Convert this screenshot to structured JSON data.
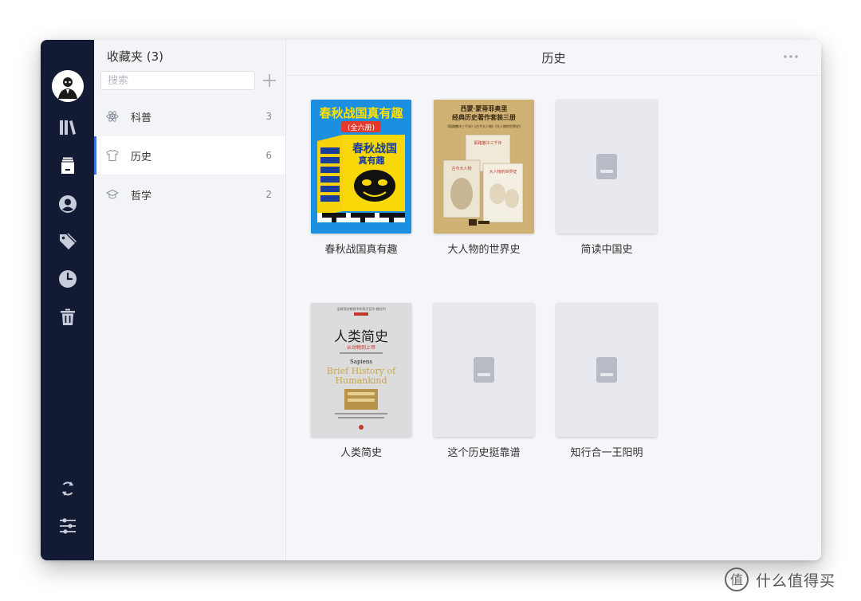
{
  "sidebar_nav": {
    "items": [
      {
        "name": "library-icon"
      },
      {
        "name": "collections-icon",
        "active": true
      },
      {
        "name": "user-icon"
      },
      {
        "name": "tag-icon"
      },
      {
        "name": "clock-icon"
      },
      {
        "name": "trash-icon"
      }
    ],
    "bottom": [
      {
        "name": "sync-icon"
      },
      {
        "name": "settings-sliders-icon"
      }
    ],
    "active_color": "#ffffff",
    "icon_color": "#c7ccda"
  },
  "collections_panel": {
    "title": "收藏夹 (3)",
    "search_placeholder": "搜索",
    "search_value": "",
    "add_icon": "plus-icon",
    "items": [
      {
        "icon": "atom-icon",
        "label": "科普",
        "count": "3"
      },
      {
        "icon": "shirt-icon",
        "label": "历史",
        "count": "6",
        "active": true
      },
      {
        "icon": "graduation-cap-icon",
        "label": "哲学",
        "count": "2"
      }
    ],
    "accent_color": "#3c72e6"
  },
  "main": {
    "title": "历史",
    "more_icon": "more-dots-icon",
    "books": [
      {
        "title": "春秋战国真有趣",
        "cover": {
          "type": "art-cspring",
          "headline": "春秋战国真有趣",
          "subtitle": "(全六册)",
          "box_title_1": "春秋战国",
          "box_title_2": "真有趣"
        }
      },
      {
        "title": "大人物的世界史",
        "cover": {
          "type": "art-bigpeople",
          "line1": "西蒙·蒙蒂菲奥里",
          "line2": "经典历史著作套装三册",
          "line3": "《耶路撒冷三千年》《古今大人物》《大人物的世界史》",
          "b1": "耶路撒冷三千年",
          "b2": "古今大人物",
          "b3": "大人物的世界史"
        }
      },
      {
        "title": "简读中国史",
        "cover": {
          "type": "placeholder"
        }
      },
      {
        "title": "人类简史",
        "cover": {
          "type": "art-sapiens",
          "top": "全球顶尖畅销书作家尤瓦尔·赫拉利",
          "cn_title": "人类简史",
          "cn_sub": "从动物到上帝",
          "en_1": "Sapiens",
          "en_2": "Brief History of",
          "en_3": "Humankind"
        }
      },
      {
        "title": "这个历史挺靠谱",
        "cover": {
          "type": "placeholder"
        }
      },
      {
        "title": "知行合一王阳明",
        "cover": {
          "type": "placeholder"
        }
      }
    ]
  },
  "watermark": {
    "text": "什么值得买",
    "icon": "zhidemai-logo-icon"
  }
}
